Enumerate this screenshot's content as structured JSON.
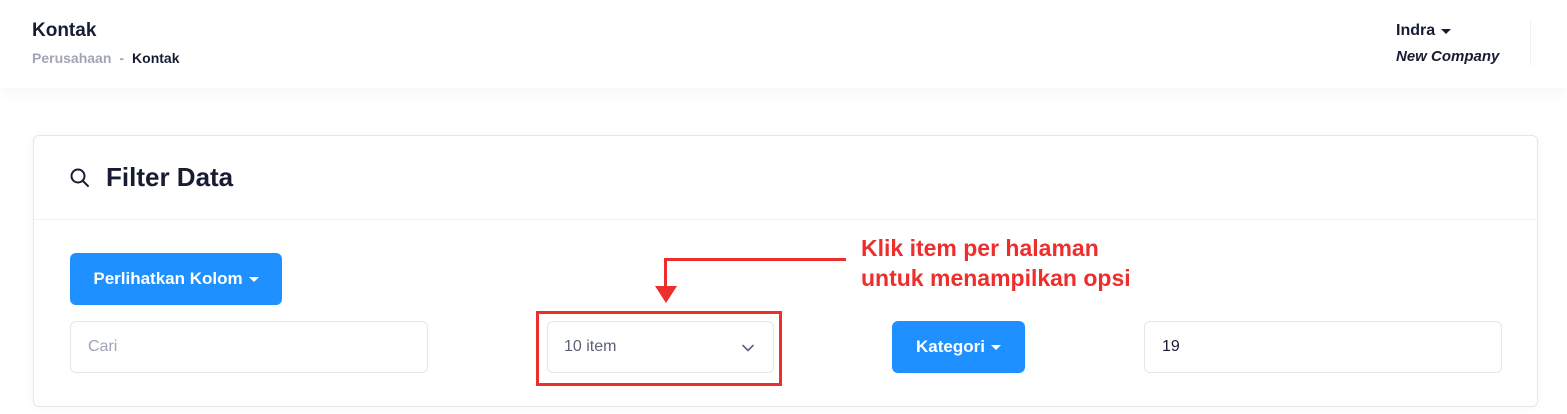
{
  "header": {
    "title": "Kontak",
    "breadcrumb": [
      "Perusahaan",
      "-",
      "Kontak"
    ],
    "user_name": "Indra",
    "company": "New Company"
  },
  "card": {
    "title": "Filter Data",
    "show_columns_label": "Perlihatkan Kolom",
    "search_placeholder": "Cari",
    "per_page_value": "10 item",
    "category_label": "Kategori",
    "number_value": "19"
  },
  "annotation": {
    "line1": "Klik item per halaman",
    "line2": "untuk menampilkan opsi"
  },
  "colors": {
    "primary": "#1e90ff",
    "annotation": "#ee2d2d",
    "text_dark": "#181c32",
    "text_muted": "#a1a5b7"
  }
}
